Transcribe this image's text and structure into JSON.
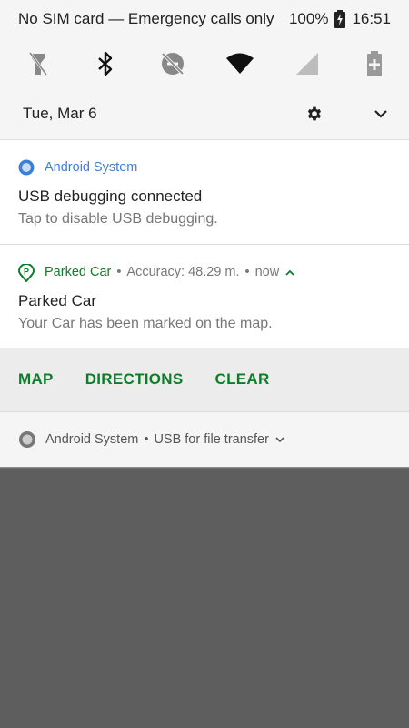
{
  "status_bar": {
    "carrier": "No SIM card — Emergency calls only",
    "battery": "100%",
    "time": "16:51"
  },
  "quick_settings": [
    "flashlight",
    "bluetooth",
    "do-not-disturb-off",
    "wifi",
    "cellular-signal",
    "battery-saver"
  ],
  "date_row": {
    "date": "Tue, Mar 6"
  },
  "notifications": [
    {
      "app": "Android System",
      "title": "USB debugging connected",
      "body": "Tap to disable USB debugging."
    },
    {
      "app": "Parked Car",
      "meta": "Accuracy: 48.29 m.",
      "time": "now",
      "title": "Parked Car",
      "body": "Your Car has been marked on the map.",
      "actions": [
        "MAP",
        "DIRECTIONS",
        "CLEAR"
      ]
    },
    {
      "app": "Android System",
      "summary": "USB for file transfer"
    }
  ],
  "colors": {
    "accent_blue": "#3d7fd6",
    "accent_green": "#0f7c2a",
    "shade_bg": "#f5f5f5",
    "scrim": "#5e5e5e"
  }
}
